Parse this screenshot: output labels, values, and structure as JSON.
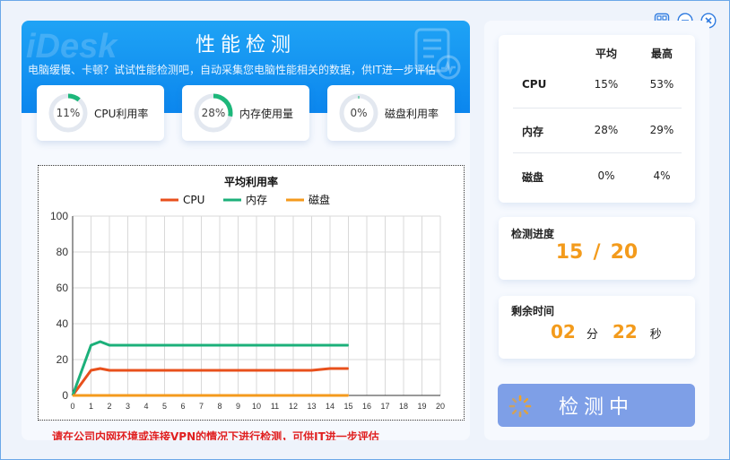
{
  "window": {
    "controls": [
      "qrcode-icon",
      "minimize-icon",
      "close-icon"
    ]
  },
  "banner": {
    "watermark": "iDesk",
    "title": "性能检测",
    "subtitle": "电脑缓慢、卡顿？试试性能检测吧，自动采集您电脑性能相关的数据，供IT进一步评估"
  },
  "metrics": [
    {
      "percent": 11,
      "percent_text": "11%",
      "label": "CPU利用率",
      "color": "#1db77a"
    },
    {
      "percent": 28,
      "percent_text": "28%",
      "label": "内存使用量",
      "color": "#1db77a"
    },
    {
      "percent": 0,
      "percent_text": "0%",
      "label": "磁盘利用率",
      "color": "#1db77a"
    }
  ],
  "chart_data": {
    "type": "line",
    "title": "平均利用率",
    "xlim": [
      0,
      20
    ],
    "ylim": [
      0,
      100
    ],
    "x_ticks": [
      "0",
      "1",
      "2",
      "3",
      "4",
      "5",
      "6",
      "7",
      "8",
      "9",
      "10",
      "11",
      "12",
      "13",
      "14",
      "15",
      "16",
      "17",
      "18",
      "19",
      "20"
    ],
    "y_ticks": [
      "0",
      "20",
      "40",
      "60",
      "80",
      "100"
    ],
    "grid": true,
    "legend_position": "top-center",
    "x": [
      0,
      1,
      1.5,
      2,
      3,
      4,
      5,
      6,
      7,
      8,
      9,
      10,
      11,
      12,
      13,
      14,
      15
    ],
    "series": [
      {
        "name": "CPU",
        "color": "#e8501c",
        "values": [
          0,
          14,
          15,
          14,
          14,
          14,
          14,
          14,
          14,
          14,
          14,
          14,
          14,
          14,
          14,
          15,
          15
        ]
      },
      {
        "name": "内存",
        "color": "#1cb07a",
        "values": [
          0,
          28,
          30,
          28,
          28,
          28,
          28,
          28,
          28,
          28,
          28,
          28,
          28,
          28,
          28,
          28,
          28
        ]
      },
      {
        "name": "磁盘",
        "color": "#f49a1d",
        "values": [
          0,
          0,
          0,
          0,
          0,
          0,
          0,
          0,
          0,
          0,
          0,
          0,
          0,
          0,
          0,
          0,
          0
        ]
      }
    ]
  },
  "warning": "请在公司内网环境或连接VPN的情况下进行检测，可供IT进一步评估",
  "stats": {
    "col_avg": "平均",
    "col_max": "最高",
    "rows": [
      {
        "name": "CPU",
        "avg": "15%",
        "max": "53%"
      },
      {
        "name": "内存",
        "avg": "28%",
        "max": "29%"
      },
      {
        "name": "磁盘",
        "avg": "0%",
        "max": "4%"
      }
    ]
  },
  "progress": {
    "title": "检测进度",
    "current": "15",
    "separator": "/",
    "total": "20"
  },
  "remaining": {
    "title": "剩余时间",
    "minutes": "02",
    "min_unit": "分",
    "seconds": "22",
    "sec_unit": "秒"
  },
  "detect_button": {
    "label": "检测中"
  }
}
